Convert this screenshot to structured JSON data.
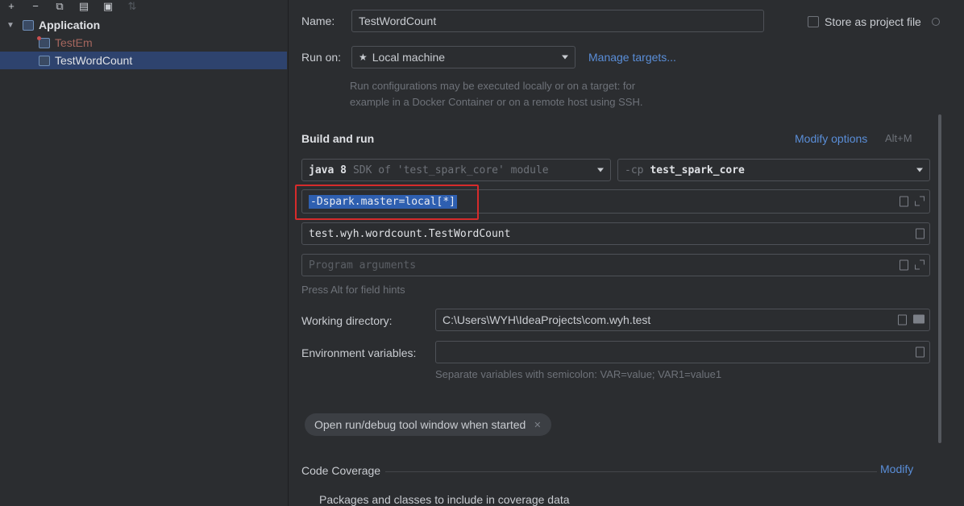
{
  "toolbar": {
    "add_icon": "+",
    "remove_icon": "−",
    "copy_icon": "⧉",
    "save_icon": "▤",
    "edit_icon": "▣",
    "sort_icon": "⇅"
  },
  "tree": {
    "root": "Application",
    "items": [
      {
        "label": "TestEm"
      },
      {
        "label": "TestWordCount"
      }
    ]
  },
  "config": {
    "name_label": "Name:",
    "name_value": "TestWordCount",
    "store_label": "Store as project file",
    "run_on_label": "Run on:",
    "run_on_value": "Local machine",
    "manage_targets": "Manage targets...",
    "run_hint_1": "Run configurations may be executed locally or on a target: for",
    "run_hint_2": "example in a Docker Container or on a remote host using SSH."
  },
  "build": {
    "title": "Build and run",
    "modify_options": "Modify options",
    "shortcut": "Alt+M",
    "jdk_value": "java 8",
    "jdk_hint": "SDK of 'test_spark_core' module",
    "cp_prefix": "-cp",
    "cp_value": "test_spark_core",
    "vm_options": "-Dspark.master=local[*]",
    "main_class": "test.wyh.wordcount.TestWordCount",
    "program_args_placeholder": "Program arguments",
    "field_hint": "Press Alt for field hints",
    "working_dir_label": "Working directory:",
    "working_dir_value": "C:\\Users\\WYH\\IdeaProjects\\com.wyh.test",
    "env_label": "Environment variables:",
    "env_hint": "Separate variables with semicolon: VAR=value; VAR1=value1",
    "open_tool_window": "Open run/debug tool window when started"
  },
  "coverage": {
    "title": "Code Coverage",
    "modify": "Modify",
    "packages_label": "Packages and classes to include in coverage data"
  },
  "colors": {
    "background": "#2b2d30",
    "selection": "#2e436e",
    "link": "#5a8ed8",
    "highlight_border": "#d62b2b",
    "text_selection": "#2e5fb0"
  }
}
